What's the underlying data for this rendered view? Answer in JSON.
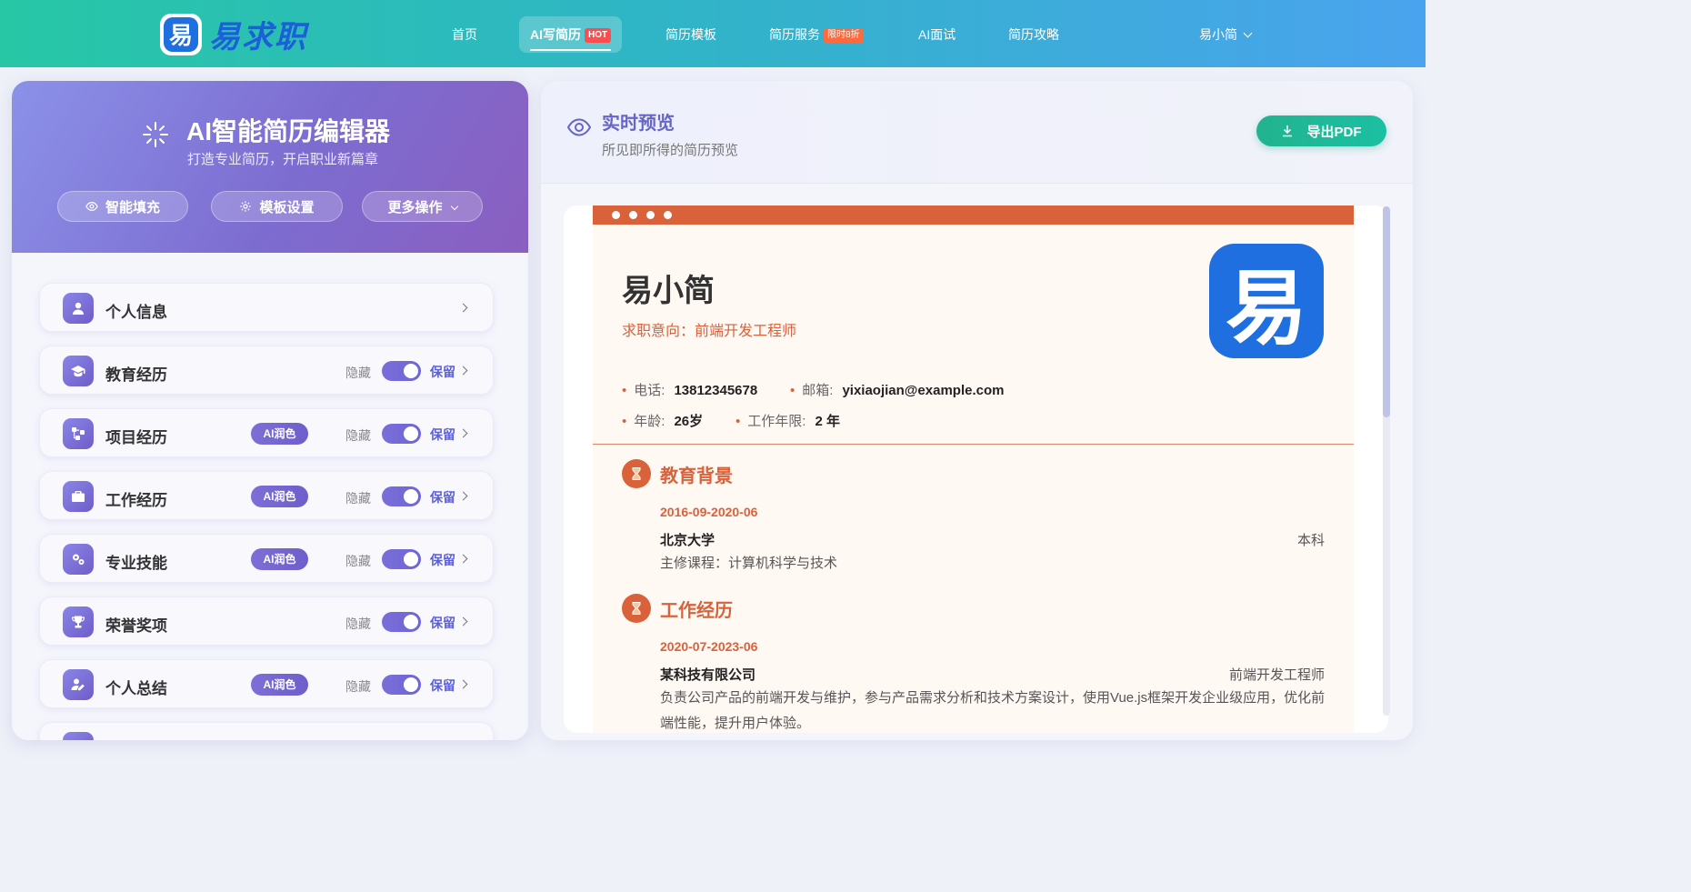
{
  "brand": {
    "logo_glyph": "易",
    "name": "易求职",
    "color": "#1d5fd8"
  },
  "nav": {
    "home": "首页",
    "ai_resume": "AI写简历",
    "ai_resume_badge": "HOT",
    "templates": "简历模板",
    "services": "简历服务",
    "services_badge": "限时8折",
    "interview": "AI面试",
    "guide": "简历攻略",
    "user": "易小简"
  },
  "editor": {
    "title": "AI智能简历编辑器",
    "subtitle": "打造专业简历，开启职业新篇章",
    "buttons": {
      "smart_fill": "智能填充",
      "template_settings": "模板设置",
      "more": "更多操作"
    },
    "ai_label": "AI润色",
    "hide_label": "隐藏",
    "keep_label": "保留",
    "sections": [
      {
        "label": "个人信息",
        "icon": "user-icon"
      },
      {
        "label": "教育经历",
        "icon": "graduation-cap-icon"
      },
      {
        "label": "项目经历",
        "icon": "project-tree-icon"
      },
      {
        "label": "工作经历",
        "icon": "briefcase-icon"
      },
      {
        "label": "专业技能",
        "icon": "gears-icon"
      },
      {
        "label": "荣誉奖项",
        "icon": "trophy-icon"
      },
      {
        "label": "个人总结",
        "icon": "user-edit-icon"
      }
    ]
  },
  "preview": {
    "title": "实时预览",
    "subtitle": "所见即所得的简历预览",
    "export": "导出PDF"
  },
  "resume": {
    "accent": "#d9623a",
    "avatar_glyph": "易",
    "name": "易小简",
    "intent": "求职意向：前端开发工程师",
    "phone_label": "电话:",
    "phone": "13812345678",
    "email_label": "邮箱:",
    "email": "yixiaojian@example.com",
    "age_label": "年龄:",
    "age": "26岁",
    "years_label": "工作年限:",
    "years": "2 年",
    "education": {
      "title": "教育背景",
      "date": "2016-09-2020-06",
      "school": "北京大学",
      "degree": "本科",
      "course": "主修课程：计算机科学与技术"
    },
    "work": {
      "title": "工作经历",
      "date": "2020-07-2023-06",
      "company": "某科技有限公司",
      "position": "前端开发工程师",
      "desc": "负责公司产品的前端开发与维护，参与产品需求分析和技术方案设计，使用Vue.js框架开发企业级应用，优化前端性能，提升用户体验。"
    }
  }
}
